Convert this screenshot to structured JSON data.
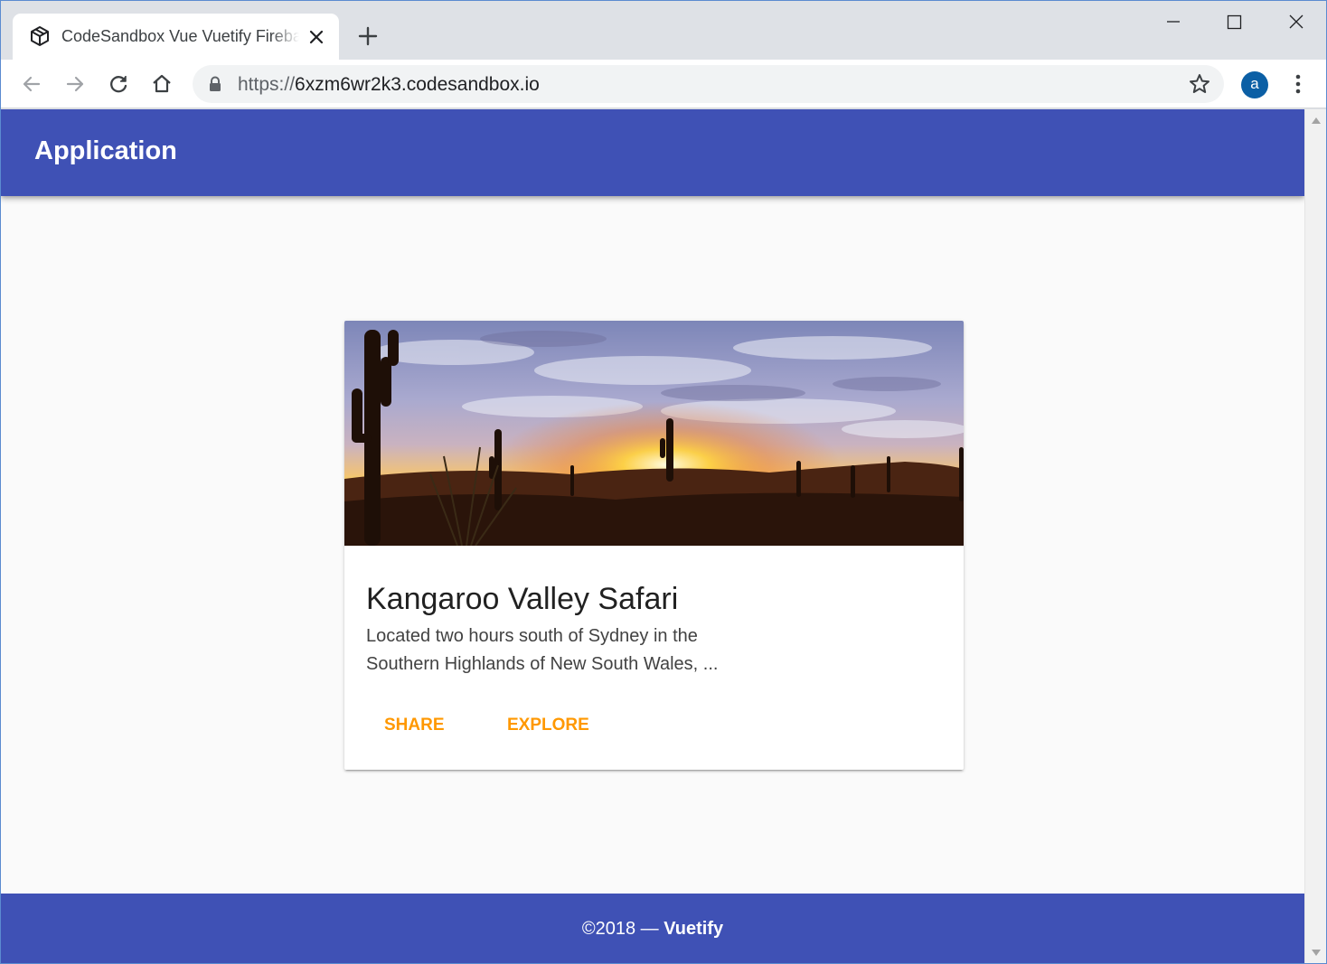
{
  "browser": {
    "tab_title": "CodeSandbox Vue Vuetify Firebase",
    "url_scheme": "https://",
    "url_host": "6xzm6wr2k3.codesandbox.io",
    "profile_initial": "a",
    "icons": {
      "favicon": "codesandbox-cube-icon",
      "tab_close": "close-icon",
      "new_tab": "plus-icon",
      "back": "arrow-left-icon",
      "forward": "arrow-right-icon",
      "reload": "reload-icon",
      "home": "home-icon",
      "lock": "lock-icon",
      "bookmark": "star-outline-icon",
      "menu": "vertical-dots-icon",
      "minimize": "minimize-icon",
      "maximize": "maximize-icon",
      "close_window": "close-icon"
    },
    "colors": {
      "profile": "#0b5fa5",
      "chrome": "#dee1e6"
    }
  },
  "app": {
    "title": "Application",
    "colors": {
      "primary": "#3f51b5",
      "accent": "#ff9800",
      "background": "#fafafa"
    }
  },
  "card": {
    "image": "desert sunset with saguaro cacti",
    "title": "Kangaroo Valley Safari",
    "text_line1": "Located two hours south of Sydney in the",
    "text_line2": "Southern Highlands of New South Wales, ...",
    "actions": {
      "share": "Share",
      "explore": "Explore"
    }
  },
  "footer": {
    "prefix": "©2018 — ",
    "brand": "Vuetify"
  }
}
